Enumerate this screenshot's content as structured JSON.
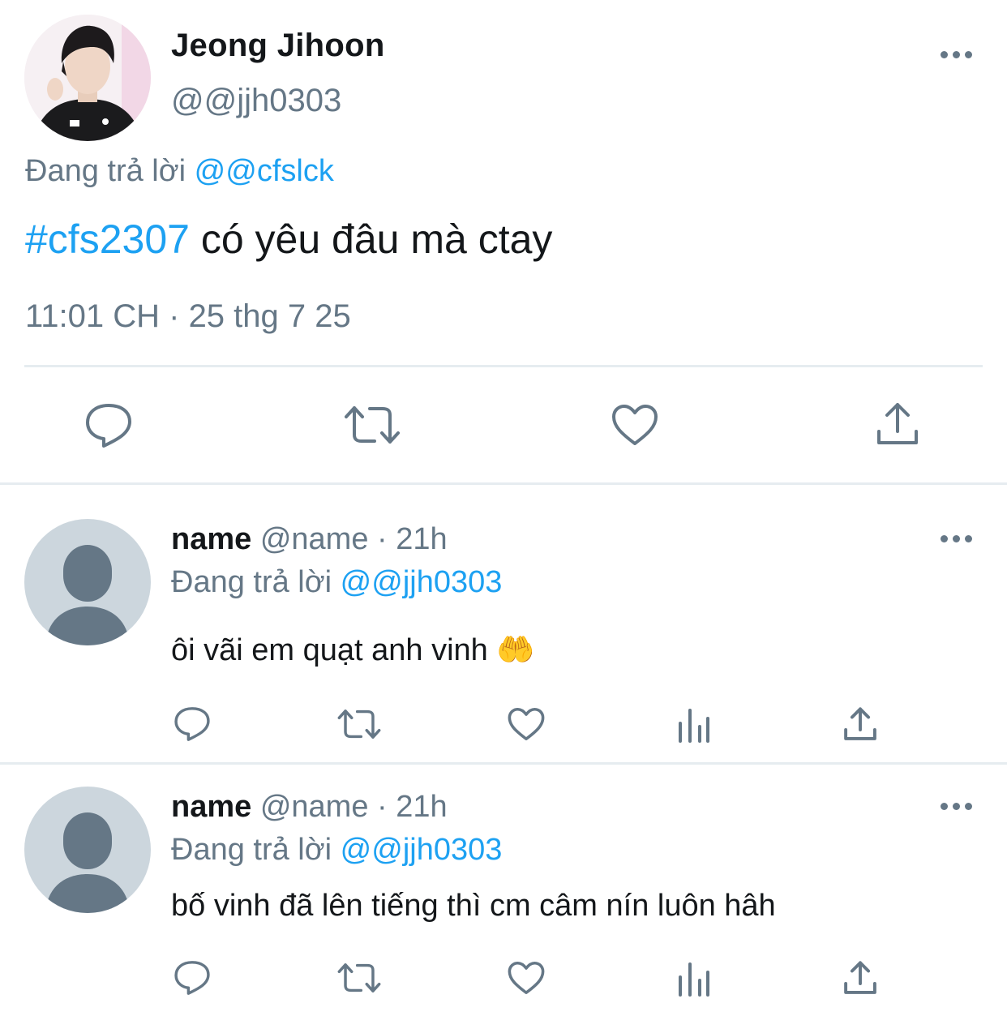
{
  "main_tweet": {
    "author_name": "Jeong Jihoon",
    "author_handle": "@@jjh0303",
    "replying_prefix": "Đang trả lời",
    "replying_to": "@@cfslck",
    "hashtag": "#cfs2307",
    "text": " có yêu đâu mà ctay",
    "timestamp": "11:01 CH · 25 thg 7 25",
    "actions": [
      "reply-icon",
      "retweet-icon",
      "like-icon",
      "share-icon"
    ]
  },
  "replies": [
    {
      "name": "name",
      "handle": "@name",
      "time": "· 21h",
      "replying_prefix": "Đang trả lời",
      "replying_to": "@@jjh0303",
      "text": "ôi vãi em quạt anh vinh",
      "emoji": "🤲",
      "actions": [
        "reply-icon",
        "retweet-icon",
        "like-icon",
        "analytics-icon",
        "share-icon"
      ]
    },
    {
      "name": "name",
      "handle": "@name",
      "time": "· 21h",
      "replying_prefix": "Đang trả lời",
      "replying_to": "@@jjh0303",
      "text": "bố vinh đã lên tiếng thì cm câm nín luôn hâh",
      "actions": [
        "reply-icon",
        "retweet-icon",
        "like-icon",
        "analytics-icon",
        "share-icon"
      ]
    }
  ],
  "colors": {
    "link": "#1da1f2",
    "secondary_text": "#657786",
    "divider": "#e6ecf0",
    "default_avatar_bg": "#ccd6dd",
    "default_avatar_fg": "#657786"
  }
}
